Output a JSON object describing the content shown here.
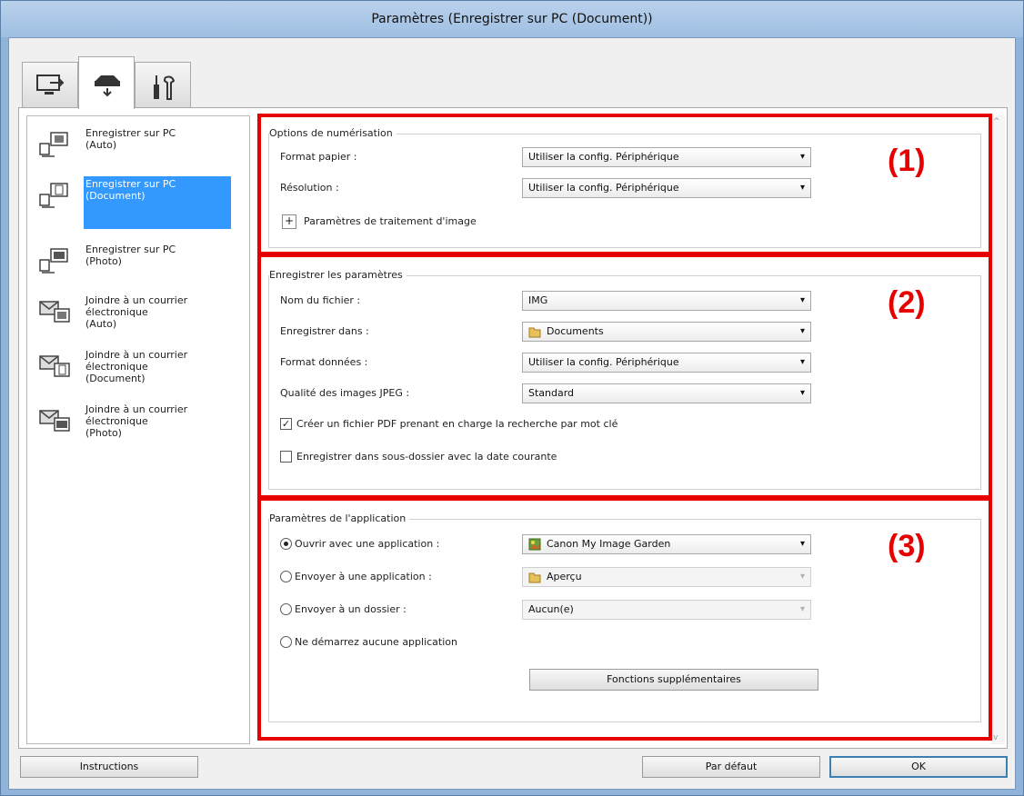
{
  "window": {
    "title": "Paramètres (Enregistrer sur PC (Document))"
  },
  "tabs": [
    {
      "icon": "scan-to-pc-icon"
    },
    {
      "icon": "scanner-icon",
      "active": true
    },
    {
      "icon": "tools-icon"
    }
  ],
  "sidebar": {
    "items": [
      {
        "label": "Enregistrer sur PC\n(Auto)",
        "icon": "save-auto-icon"
      },
      {
        "label": "Enregistrer sur PC\n(Document)",
        "icon": "save-document-icon",
        "selected": true
      },
      {
        "label": "Enregistrer sur PC\n(Photo)",
        "icon": "save-photo-icon"
      },
      {
        "label": "Joindre à un courrier\nélectronique\n(Auto)",
        "icon": "mail-auto-icon"
      },
      {
        "label": "Joindre à un courrier\nélectronique\n(Document)",
        "icon": "mail-document-icon"
      },
      {
        "label": "Joindre à un courrier\nélectronique\n(Photo)",
        "icon": "mail-photo-icon"
      }
    ]
  },
  "scan_options": {
    "title": "Options de numérisation",
    "number": "(1)",
    "paper_size_label": "Format papier :",
    "paper_size_value": "Utiliser la config. Périphérique",
    "resolution_label": "Résolution :",
    "resolution_value": "Utiliser la config. Périphérique",
    "image_processing_label": "Paramètres de traitement d'image",
    "expand_symbol": "+"
  },
  "save_settings": {
    "title": "Enregistrer les paramètres",
    "number": "(2)",
    "file_name_label": "Nom du fichier :",
    "file_name_value": "IMG",
    "save_in_label": "Enregistrer dans :",
    "save_in_value": "Documents",
    "data_format_label": "Format données :",
    "data_format_value": "Utiliser la config. Périphérique",
    "jpeg_quality_label": "Qualité des images JPEG :",
    "jpeg_quality_value": "Standard",
    "searchable_pdf_label": "Créer un fichier PDF prenant en charge la recherche par mot clé",
    "searchable_pdf_checked": true,
    "subfolder_label": "Enregistrer dans sous-dossier avec la date courante",
    "subfolder_checked": false
  },
  "app_settings": {
    "title": "Paramètres de l'application",
    "number": "(3)",
    "open_with_label": "Ouvrir avec une application :",
    "open_with_value": "Canon My Image Garden",
    "send_to_app_label": "Envoyer à une application :",
    "send_to_app_value": "Aperçu",
    "send_to_folder_label": "Envoyer à un dossier :",
    "send_to_folder_value": "Aucun(e)",
    "no_app_label": "Ne démarrez aucune application",
    "selected_option": "open_with",
    "more_functions_label": "Fonctions supplémentaires"
  },
  "footer": {
    "instructions_label": "Instructions",
    "default_label": "Par défaut",
    "ok_label": "OK"
  },
  "colors": {
    "highlight": "#e60000",
    "selection": "#3399ff",
    "titlebar": "#9fbfe2"
  }
}
